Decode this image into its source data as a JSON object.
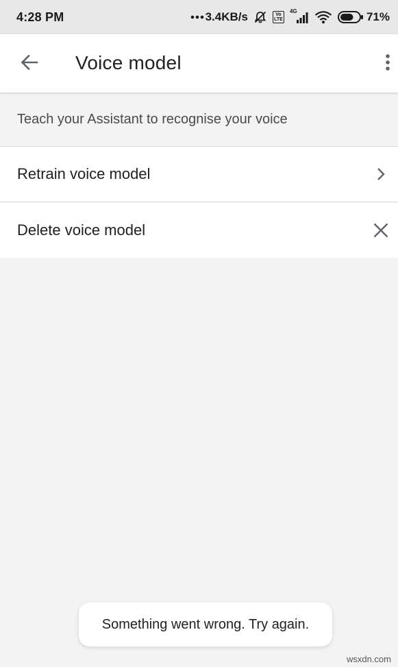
{
  "status_bar": {
    "time": "4:28 PM",
    "network_speed": "3.4KB/s",
    "lte_label": "Vo LTE",
    "network_type": "4G",
    "battery_percent": "71%",
    "battery_level": 0.71,
    "icons": [
      "dots-icon",
      "mute-bell-icon",
      "volte-icon",
      "signal-icon",
      "wifi-icon",
      "battery-icon"
    ]
  },
  "app_bar": {
    "title": "Voice model",
    "icons": [
      "back-arrow-icon",
      "more-vert-icon"
    ]
  },
  "description": "Teach your Assistant to recognise your voice",
  "items": [
    {
      "label": "Retrain voice model",
      "icon": "chevron-right-icon"
    },
    {
      "label": "Delete voice model",
      "icon": "close-icon"
    }
  ],
  "toast": "Something went wrong. Try again.",
  "watermark": "wsxdn.com",
  "colors": {
    "background": "#f3f3f3",
    "surface": "#ffffff",
    "status_bar": "#e8e8e8",
    "icon_grey": "#5f6368",
    "text_primary": "#202124"
  }
}
